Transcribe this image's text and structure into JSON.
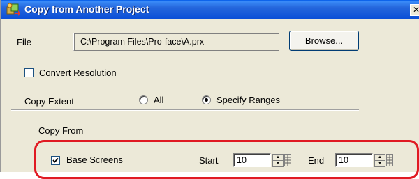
{
  "window": {
    "title": "Copy from Another Project",
    "icon": "project-copy-icon",
    "close_glyph": "✕"
  },
  "file": {
    "label": "File",
    "path": "C:\\Program Files\\Pro-face\\A.prx",
    "browse_label": "Browse..."
  },
  "convert_resolution": {
    "label": "Convert Resolution",
    "checked": false
  },
  "copy_extent": {
    "label": "Copy Extent",
    "options": [
      {
        "label": "All",
        "selected": false
      },
      {
        "label": "Specify Ranges",
        "selected": true
      }
    ]
  },
  "copy_from": {
    "label": "Copy From",
    "base_screens": {
      "label": "Base Screens",
      "checked": true,
      "start_label": "Start",
      "start_value": "10",
      "end_label": "End",
      "end_value": "10"
    }
  },
  "colors": {
    "titlebar": "#0b4fd7",
    "highlight": "#e01a22",
    "dialog_bg": "#ece9d8"
  }
}
